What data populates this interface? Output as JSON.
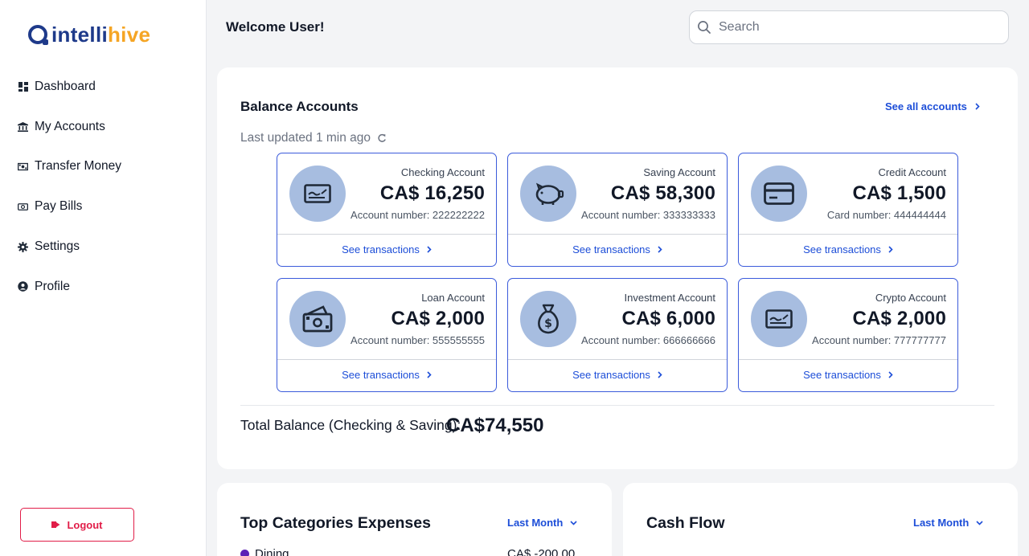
{
  "brand": {
    "name_part1": "intelli",
    "name_part2": "hive"
  },
  "sidebar": {
    "items": [
      {
        "label": "Dashboard",
        "icon": "dashboard-icon"
      },
      {
        "label": "My Accounts",
        "icon": "bank-icon"
      },
      {
        "label": "Transfer Money",
        "icon": "money-transfer-icon"
      },
      {
        "label": "Pay Bills",
        "icon": "bills-icon"
      },
      {
        "label": "Settings",
        "icon": "gear-icon"
      },
      {
        "label": "Profile",
        "icon": "user-circle-icon"
      }
    ],
    "logout_label": "Logout"
  },
  "header": {
    "welcome": "Welcome User!",
    "search_placeholder": "Search"
  },
  "balance": {
    "title": "Balance Accounts",
    "see_all": "See all accounts",
    "updated": "Last updated 1 min ago",
    "accounts": [
      {
        "type": "Checking Account",
        "amount": "CA$ 16,250",
        "number": "Account number: 222222222",
        "link": "See transactions",
        "icon": "checking-card-icon"
      },
      {
        "type": "Saving Account",
        "amount": "CA$ 58,300",
        "number": "Account number: 333333333",
        "link": "See transactions",
        "icon": "piggy-bank-icon"
      },
      {
        "type": "Credit Account",
        "amount": "CA$ 1,500",
        "number": "Card number: 444444444",
        "link": "See transactions",
        "icon": "credit-card-icon"
      },
      {
        "type": "Loan Account",
        "amount": "CA$ 2,000",
        "number": "Account number: 555555555",
        "link": "See transactions",
        "icon": "cash-bills-icon"
      },
      {
        "type": "Investment Account",
        "amount": "CA$ 6,000",
        "number": "Account number: 666666666",
        "link": "See transactions",
        "icon": "money-bag-icon"
      },
      {
        "type": "Crypto Account",
        "amount": "CA$ 2,000",
        "number": "Account number: 777777777",
        "link": "See transactions",
        "icon": "crypto-card-icon"
      }
    ],
    "total_label": "Total Balance (Checking & Saving):",
    "total_value": "CA$74,550"
  },
  "expenses": {
    "title": "Top Categories Expenses",
    "filter": "Last Month",
    "rows": [
      {
        "category": "Dining",
        "amount": "CA$ -200.00",
        "color": "#5b21b6"
      }
    ]
  },
  "cashflow": {
    "title": "Cash Flow",
    "filter": "Last Month"
  },
  "colors": {
    "brand_primary": "#1e3a8a",
    "brand_accent": "#f5a524",
    "link": "#1d4ed8",
    "danger": "#e11d48",
    "icon_circle": "#a7bde0"
  }
}
